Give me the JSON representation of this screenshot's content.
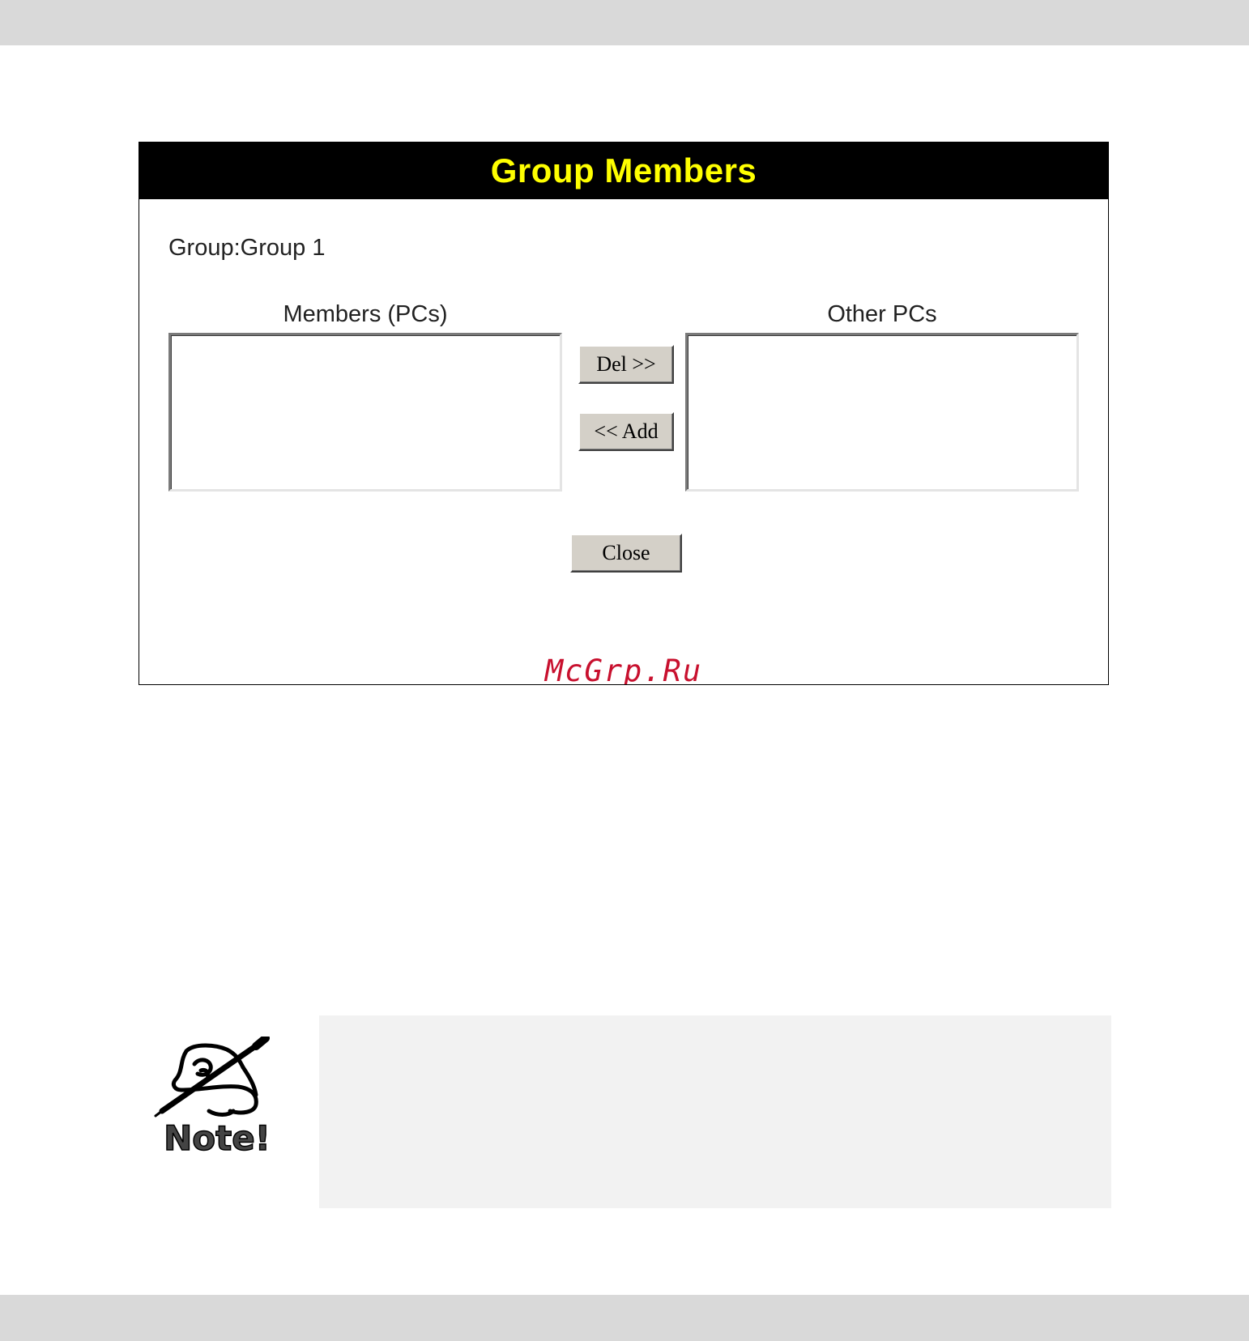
{
  "panel": {
    "title": "Group Members",
    "group_line": "Group:Group 1",
    "members_label": "Members (PCs)",
    "others_label": "Other PCs",
    "members_items": [],
    "other_items": [],
    "del_button": "Del >>",
    "add_button": "<< Add",
    "close_button": "Close",
    "title_color": "#ffff00",
    "header_color": "#000000"
  },
  "watermark": "McGrp.Ru",
  "note": {
    "icon": "note-pen-icon",
    "label": "Note!"
  }
}
